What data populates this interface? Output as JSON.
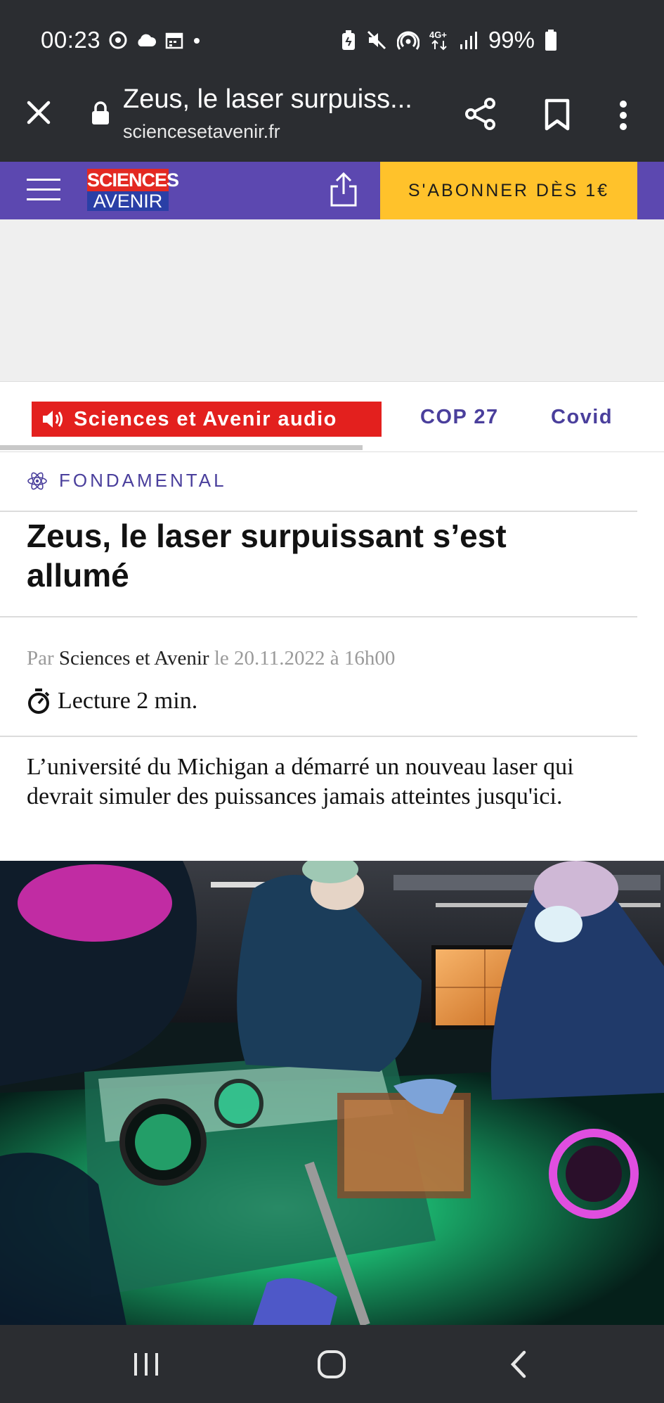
{
  "status_bar": {
    "time": "00:23",
    "battery": "99%",
    "network": "4G+"
  },
  "browser": {
    "title": "Zeus, le laser surpuiss...",
    "url": "sciencesetavenir.fr"
  },
  "site": {
    "logo_top": "SCIENCES",
    "logo_bottom": "AVENIR",
    "subscribe_label": "S'ABONNER DÈS 1€"
  },
  "topics": {
    "audio": "Sciences et Avenir audio",
    "items": [
      "COP 27",
      "Covid"
    ]
  },
  "article": {
    "category": "FONDAMENTAL",
    "headline": "Zeus, le laser surpuissant s’est allumé",
    "byline_prefix": "Par",
    "author": "Sciences et Avenir",
    "byline_date": "le 20.11.2022 à 16h00",
    "reading_time": "Lecture 2 min.",
    "lead": "L’université du Michigan a démarré un nouveau laser qui devrait simuler des puissances jamais atteintes jusqu'ici."
  },
  "colors": {
    "brand_purple": "#5c48b0",
    "subscribe_yellow": "#ffc22b",
    "audio_red": "#e3201e",
    "topic_link": "#4a3f9c",
    "system_bar": "#2b2d31"
  }
}
